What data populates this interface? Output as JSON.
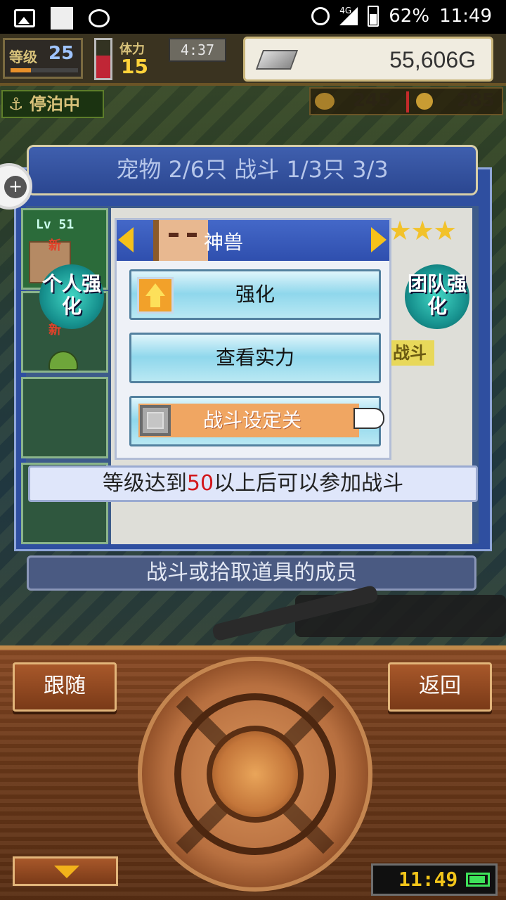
{
  "status_bar": {
    "network": "4G",
    "battery_percent": "62%",
    "time": "11:49"
  },
  "hud": {
    "level_label": "等级",
    "level_value": "25",
    "stamina_label": "体力",
    "stamina_value": "15",
    "timer": "4:37",
    "gold": "55,606G",
    "dock_status": "停泊中",
    "resource_a": "245",
    "resource_b": "285"
  },
  "pet_window": {
    "title": "宠物 2/6只 战斗 1/3只 3/3",
    "slot1_level": "Lv 51",
    "slot1_new": "新",
    "slot2_new": "新",
    "personal_upgrade": "个人强化",
    "team_upgrade": "团队强化",
    "battle_tag": "战斗",
    "stars": "★★★"
  },
  "popup": {
    "title": "神兽",
    "strengthen": "强化",
    "view_strength": "查看实力",
    "battle_setting": "战斗设定关"
  },
  "notice": {
    "prefix": "等级达到",
    "level": "50",
    "suffix": "以上后可以参加战斗"
  },
  "members_label": "战斗或拾取道具的成员",
  "controller": {
    "follow": "跟随",
    "back": "返回",
    "game_clock": "11:49"
  },
  "colors": {
    "accent_blue": "#2f4fae",
    "gold": "#f5c11a",
    "notice_red": "#d2161a"
  }
}
